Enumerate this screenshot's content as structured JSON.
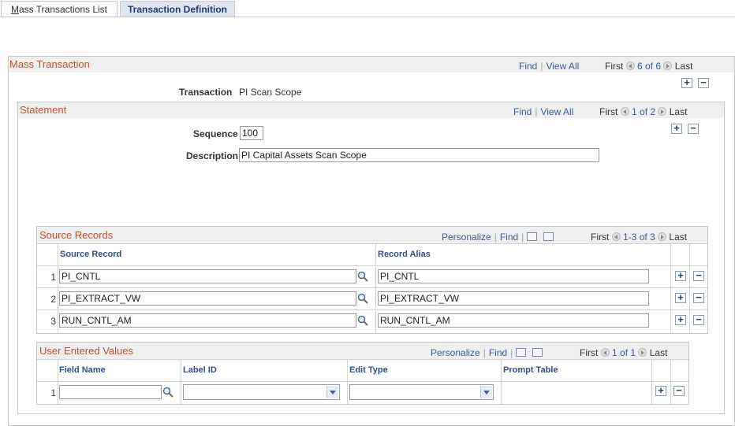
{
  "tabs": [
    {
      "label": "Mass Transactions List",
      "underline_char": "M",
      "rest": "ass Transactions List"
    },
    {
      "label": "Transaction Definition"
    }
  ],
  "mass_transaction": {
    "title": "Mass Transaction",
    "nav": {
      "find": "Find",
      "view_all": "View All",
      "first": "First",
      "range": "6 of 6",
      "last": "Last"
    },
    "transaction_label": "Transaction",
    "transaction_value": "PI Scan Scope"
  },
  "statement": {
    "title": "Statement",
    "nav": {
      "find": "Find",
      "view_all": "View All",
      "first": "First",
      "range": "1 of 2",
      "last": "Last"
    },
    "sequence_label": "Sequence",
    "sequence_value": "100",
    "description_label": "Description",
    "description_value": "PI Capital Assets Scan Scope"
  },
  "source_records": {
    "title": "Source Records",
    "nav": {
      "personalize": "Personalize",
      "find": "Find",
      "first": "First",
      "range": "1-3 of 3",
      "last": "Last"
    },
    "columns": [
      "Source Record",
      "Record Alias"
    ],
    "rows": [
      {
        "num": "1",
        "record": "PI_CNTL",
        "alias": "PI_CNTL"
      },
      {
        "num": "2",
        "record": "PI_EXTRACT_VW",
        "alias": "PI_EXTRACT_VW"
      },
      {
        "num": "3",
        "record": "RUN_CNTL_AM",
        "alias": "RUN_CNTL_AM"
      }
    ]
  },
  "user_values": {
    "title": "User Entered Values",
    "nav": {
      "personalize": "Personalize",
      "find": "Find",
      "first": "First",
      "range": "1 of 1",
      "last": "Last"
    },
    "columns": [
      "Field Name",
      "Label ID",
      "Edit Type",
      "Prompt Table"
    ],
    "rows": [
      {
        "num": "1",
        "field_name": "",
        "label_id": "",
        "edit_type": "",
        "prompt_table": ""
      }
    ]
  },
  "symbols": {
    "add": "+",
    "remove": "−"
  },
  "icons": {
    "lookup": "magnifier-icon",
    "zoom": "view-grid-icon",
    "download": "download-excel-icon"
  },
  "colors": {
    "title": "#c05327",
    "link": "#3a5c9b",
    "header_bg": "#efefef",
    "grid_header": "#2f4f87"
  }
}
